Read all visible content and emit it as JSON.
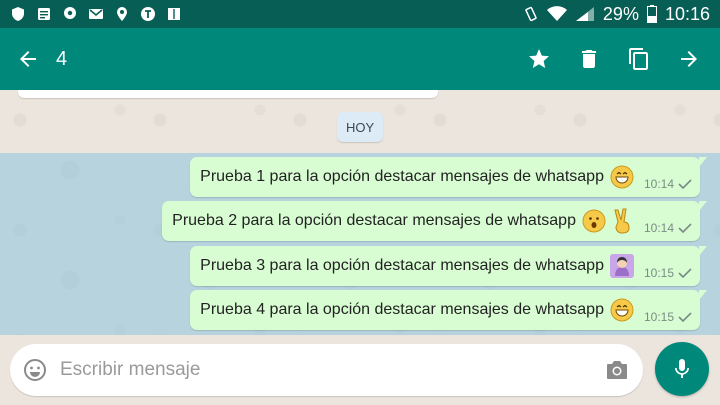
{
  "status_bar": {
    "battery_percent": "29%",
    "time": "10:16",
    "left_icons": [
      "shield-icon",
      "notes-icon",
      "location-pin-icon",
      "gmail-icon",
      "maps-pin-icon",
      "circle-t-icon",
      "book-icon"
    ],
    "right_icons": [
      "vibrate-icon",
      "wifi-icon",
      "signal-icon",
      "battery-icon"
    ]
  },
  "app_bar": {
    "selected_count": "4",
    "back_icon": "arrow-back-icon",
    "actions": [
      "star-icon",
      "delete-icon",
      "copy-icon",
      "forward-icon"
    ]
  },
  "chat": {
    "day_label": "HOY",
    "messages": [
      {
        "text": "Prueba 1 para la opción destacar mensajes de whatsapp",
        "emojis": [
          "😄"
        ],
        "time": "10:14"
      },
      {
        "text": "Prueba 2 para la opción destacar mensajes de whatsapp",
        "emojis": [
          "😮",
          "✌️"
        ],
        "time": "10:14"
      },
      {
        "text": "Prueba 3 para la opción destacar mensajes de whatsapp",
        "emojis": [
          "💁‍♀️"
        ],
        "time": "10:15"
      },
      {
        "text": "Prueba 4 para la opción destacar mensajes de whatsapp",
        "emojis": [
          "😄"
        ],
        "time": "10:15"
      }
    ]
  },
  "composer": {
    "placeholder": "Escribir mensaje",
    "value": "",
    "emoji_icon": "emoji-icon",
    "camera_icon": "camera-icon",
    "mic_icon": "mic-icon"
  },
  "colors": {
    "status_bar": "#075e54",
    "app_bar": "#00897b",
    "outgoing_bubble": "#d9fdd3",
    "selection_overlay": "#78bee1",
    "chat_background": "#ece5dd"
  }
}
